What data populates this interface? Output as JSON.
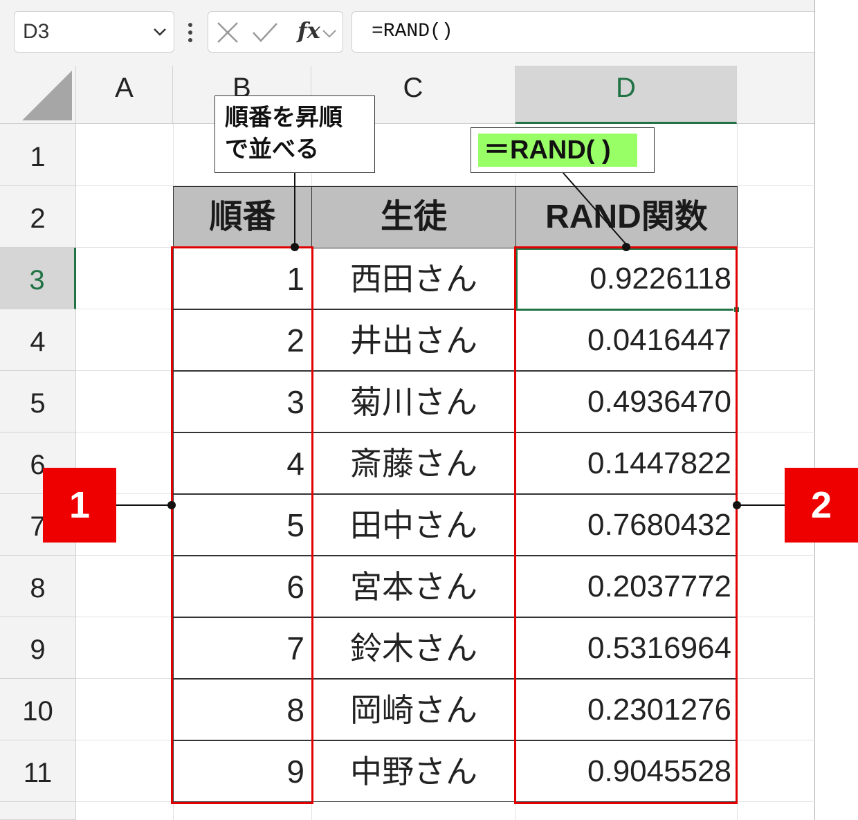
{
  "formula_bar": {
    "name_box": "D3",
    "fx_label": "fx",
    "formula": "=RAND()"
  },
  "columns": [
    "A",
    "B",
    "C",
    "D"
  ],
  "rows": [
    "1",
    "2",
    "3",
    "4",
    "5",
    "6",
    "7",
    "8",
    "9",
    "10",
    "11"
  ],
  "selected_cell": {
    "column": "D",
    "row": "3"
  },
  "table": {
    "headers": [
      "順番",
      "生徒",
      "RAND関数"
    ],
    "rows": [
      {
        "order": "1",
        "name": "西田さん",
        "rand": "0.9226118"
      },
      {
        "order": "2",
        "name": "井出さん",
        "rand": "0.0416447"
      },
      {
        "order": "3",
        "name": "菊川さん",
        "rand": "0.4936470"
      },
      {
        "order": "4",
        "name": "斎藤さん",
        "rand": "0.1447822"
      },
      {
        "order": "5",
        "name": "田中さん",
        "rand": "0.7680432"
      },
      {
        "order": "6",
        "name": "宮本さん",
        "rand": "0.2037772"
      },
      {
        "order": "7",
        "name": "鈴木さん",
        "rand": "0.5316964"
      },
      {
        "order": "8",
        "name": "岡崎さん",
        "rand": "0.2301276"
      },
      {
        "order": "9",
        "name": "中野さん",
        "rand": "0.9045528"
      }
    ]
  },
  "annotations": {
    "callout_order_line1": "順番を昇順",
    "callout_order_line2": "で並べる",
    "callout_formula": "＝RAND( )",
    "badge_1": "1",
    "badge_2": "2"
  },
  "colors": {
    "header_fill": "#bfbfbf",
    "highlight_red": "#e00000",
    "badge_red": "#ee0000",
    "formula_highlight": "#99ff66",
    "excel_green": "#217346"
  }
}
